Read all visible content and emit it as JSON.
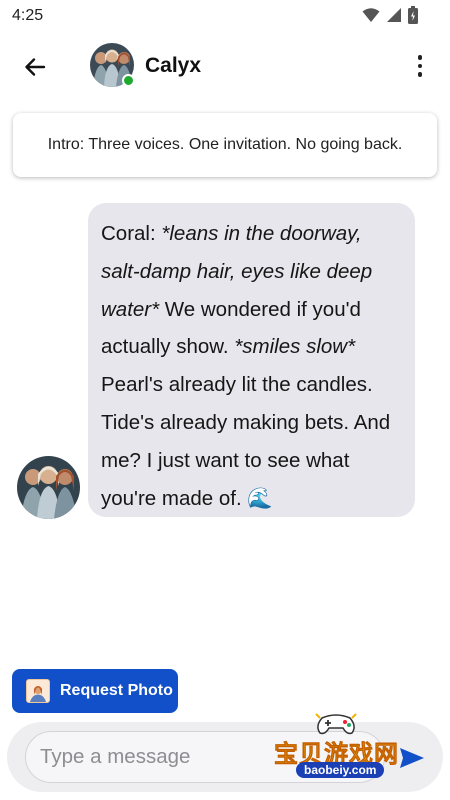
{
  "status_bar": {
    "time": "4:25",
    "icons": [
      "wifi-icon",
      "signal-icon",
      "battery-icon"
    ]
  },
  "header": {
    "back_icon": "arrow-left-icon",
    "contact_name": "Calyx",
    "online": true,
    "menu_icon": "more-vertical-icon"
  },
  "intro": {
    "text": "Intro: Three voices. One invitation. No going back."
  },
  "message": {
    "sender": "Coral",
    "parts": [
      {
        "text": "Coral: ",
        "italic": false
      },
      {
        "text": "*leans in the doorway, salt-damp hair, eyes like deep water*",
        "italic": true
      },
      {
        "text": " We wondered if you'd actually show. ",
        "italic": false
      },
      {
        "text": "*smiles slow*",
        "italic": true
      },
      {
        "text": " Pearl's already lit the candles. Tide's already making bets. And me? I just want to see what you're made of. ",
        "italic": false
      },
      {
        "text": "🌊",
        "italic": false
      }
    ]
  },
  "request_photo": {
    "label": "Request Photo",
    "icon": "portrait-icon"
  },
  "composer": {
    "placeholder": "Type a message",
    "value": "",
    "send_icon": "send-icon"
  },
  "watermark": {
    "title": "宝贝游戏网",
    "url": "baobeiy.com"
  },
  "colors": {
    "accent": "#1150c8",
    "bubble": "#e6e6ec",
    "online": "#1faa2f"
  }
}
